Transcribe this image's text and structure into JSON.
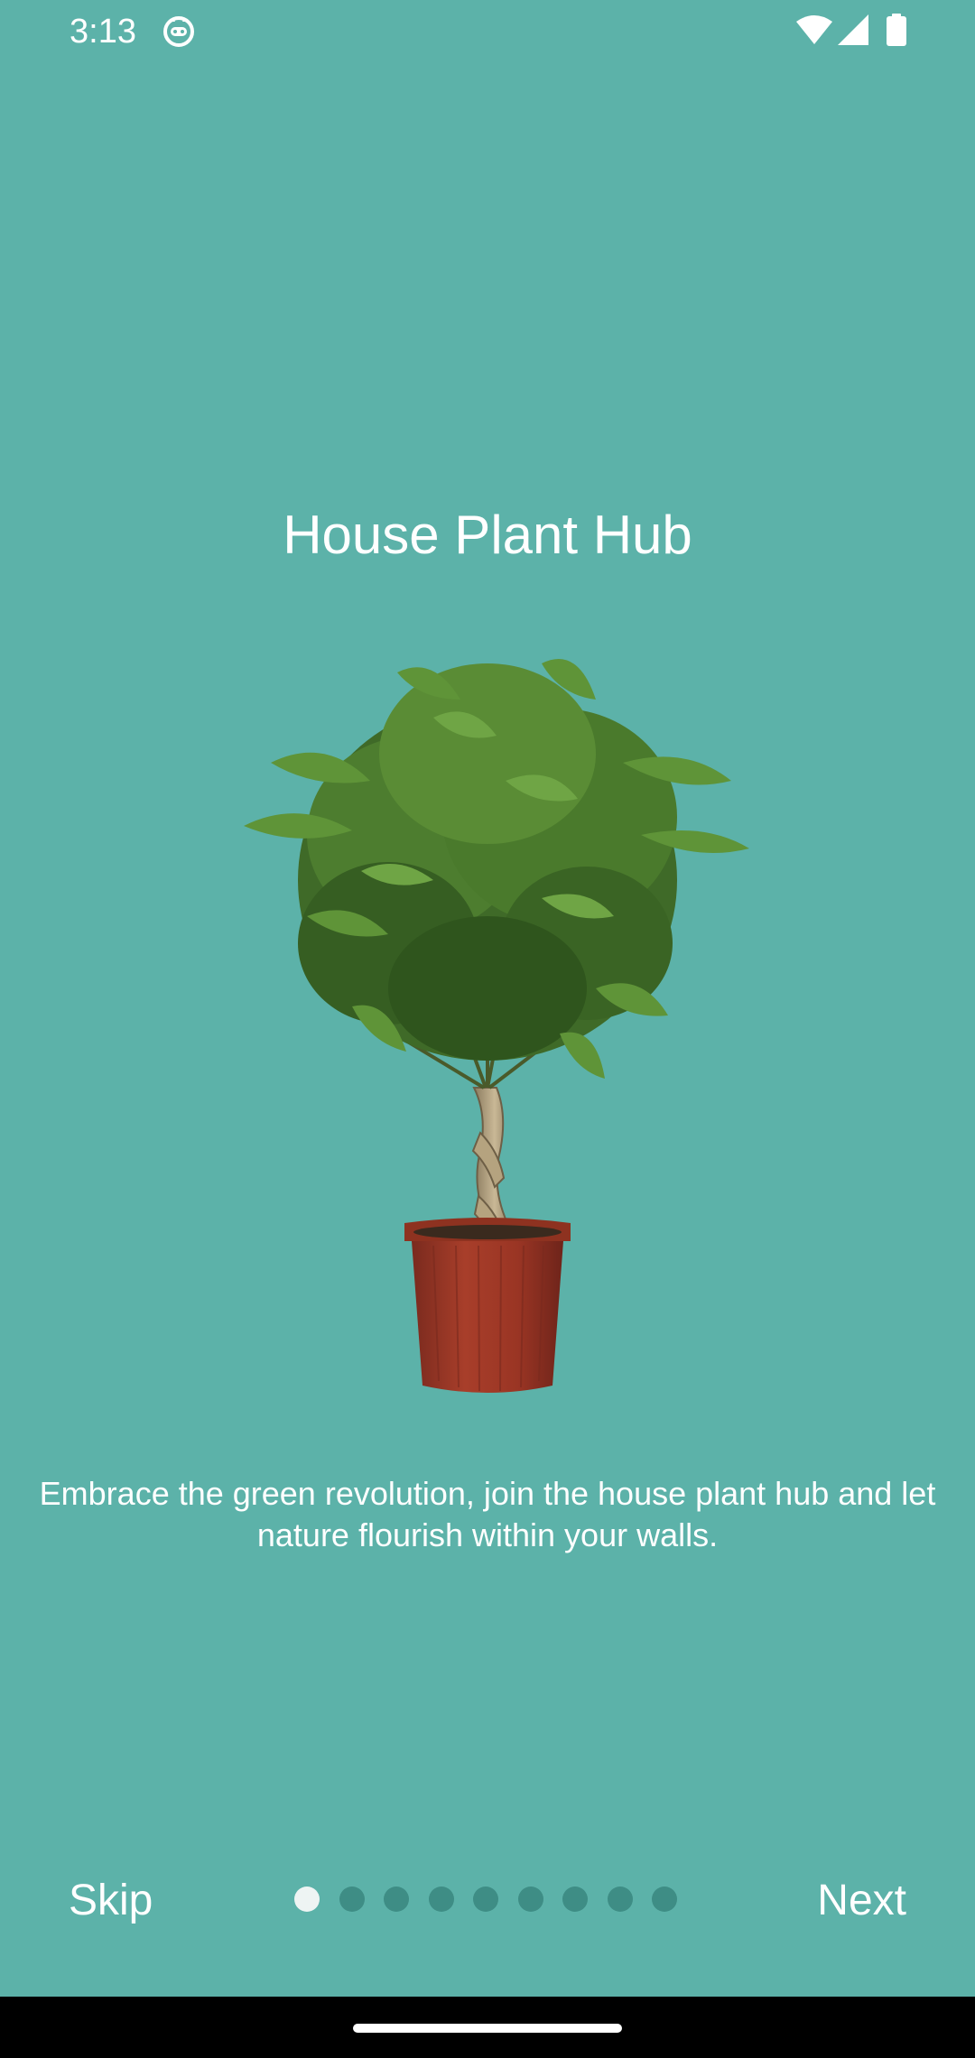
{
  "status_bar": {
    "time": "3:13",
    "icons": [
      "app-notification-icon",
      "wifi-icon",
      "signal-icon",
      "battery-icon"
    ]
  },
  "onboarding": {
    "title": "House Plant Hub",
    "image": "potted-money-tree-plant",
    "description": "Embrace the green revolution, join the house plant hub and let nature flourish within your walls."
  },
  "navigation": {
    "skip_label": "Skip",
    "next_label": "Next",
    "page_count": 9,
    "current_page": 1
  },
  "colors": {
    "background": "#5cb2a9",
    "dot_inactive": "#3e8d85",
    "dot_active": "#eef4f3",
    "text": "#ffffff"
  }
}
